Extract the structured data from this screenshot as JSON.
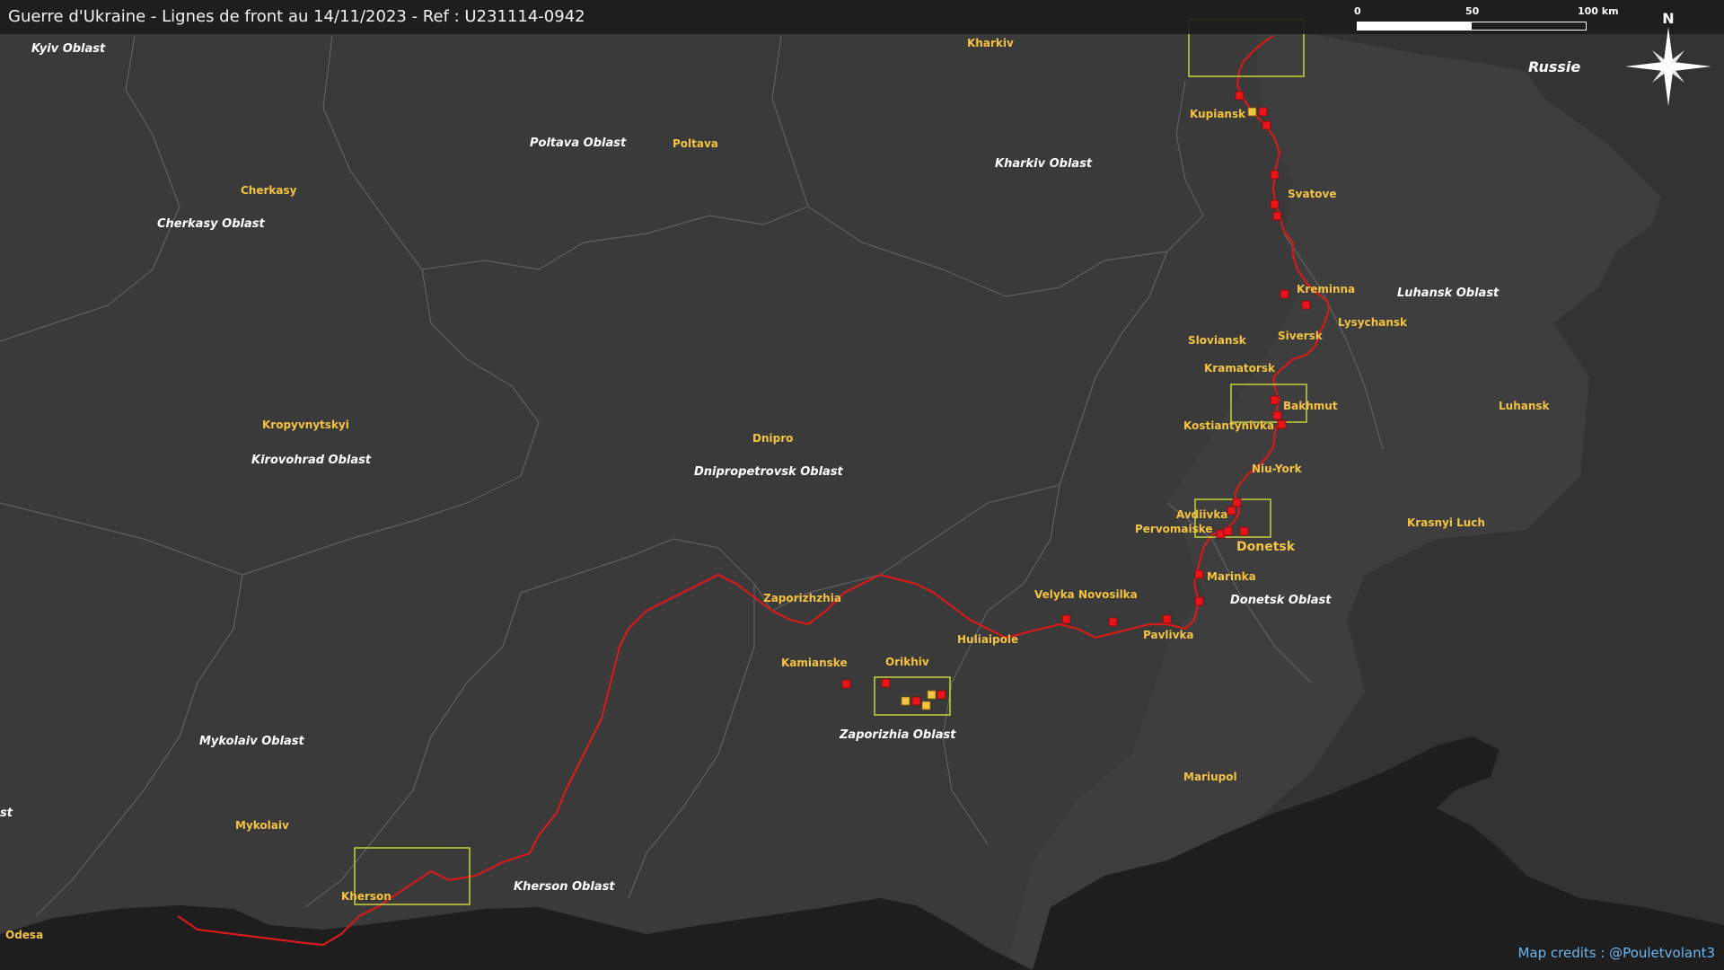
{
  "header": {
    "title": "Guerre d'Ukraine - Lignes de front au 14/11/2023 - Ref : U231114-0942"
  },
  "credits": "Map credits : @Pouletvolant3",
  "scale_bar": {
    "labels": [
      "0",
      "50",
      "100 km"
    ]
  },
  "compass": {
    "label": "N",
    "icon": "compass-rose-icon"
  },
  "colors": {
    "land": "#3a3a3a",
    "russia": "#333333",
    "sea": "#1e1e1e",
    "border": "#666666",
    "front_line": "#d41c1c",
    "city_label": "#f5c342",
    "region_label": "#ffffff",
    "engagement_red": "#e8161a",
    "engagement_yellow": "#f5c342",
    "zone_box": "#c6d43a"
  },
  "regions": [
    {
      "name": "Kyiv Oblast"
    },
    {
      "name": "Poltava Oblast"
    },
    {
      "name": "Kharkiv Oblast"
    },
    {
      "name": "Cherkasy Oblast"
    },
    {
      "name": "Luhansk Oblast"
    },
    {
      "name": "Kirovohrad Oblast"
    },
    {
      "name": "Dnipropetrovsk Oblast"
    },
    {
      "name": "Donetsk Oblast"
    },
    {
      "name": "Zaporizhia Oblast"
    },
    {
      "name": "Mykolaiv Oblast"
    },
    {
      "name": "Kherson Oblast"
    },
    {
      "name": "st"
    },
    {
      "name": "Russie"
    }
  ],
  "cities": [
    {
      "name": "Kharkiv"
    },
    {
      "name": "Kupiansk"
    },
    {
      "name": "Poltava"
    },
    {
      "name": "Cherkasy"
    },
    {
      "name": "Svatove"
    },
    {
      "name": "Kreminna"
    },
    {
      "name": "Lysychansk"
    },
    {
      "name": "Sloviansk"
    },
    {
      "name": "Siversk"
    },
    {
      "name": "Kramatorsk"
    },
    {
      "name": "Bakhmut"
    },
    {
      "name": "Kostiantynivka"
    },
    {
      "name": "Luhansk"
    },
    {
      "name": "Kropyvnytskyi"
    },
    {
      "name": "Dnipro"
    },
    {
      "name": "Niu-York"
    },
    {
      "name": "Avdiivka"
    },
    {
      "name": "Pervomaiske"
    },
    {
      "name": "Donetsk"
    },
    {
      "name": "Krasnyi Luch"
    },
    {
      "name": "Marinka"
    },
    {
      "name": "Zaporizhzhia"
    },
    {
      "name": "Velyka Novosilka"
    },
    {
      "name": "Huliaipole"
    },
    {
      "name": "Pavlivka"
    },
    {
      "name": "Kamianske"
    },
    {
      "name": "Orikhiv"
    },
    {
      "name": "Mariupol"
    },
    {
      "name": "Mykolaiv"
    },
    {
      "name": "Kherson"
    },
    {
      "name": "Odesa"
    }
  ]
}
